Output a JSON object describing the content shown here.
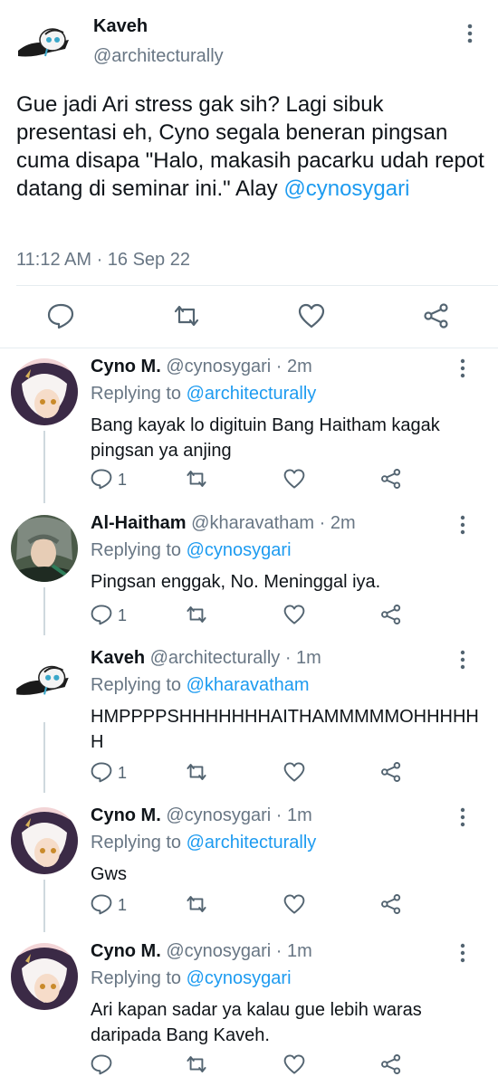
{
  "main_tweet": {
    "name": "Kaveh",
    "handle": "@architecturally",
    "text": "Gue jadi Ari stress gak sih? Lagi sibuk presentasi eh, Cyno segala beneran pingsan cuma disapa \"Halo, makasih pacarku udah repot datang di seminar ini.\" Alay ",
    "mention": "@cynosygari",
    "timestamp": "11:12 AM · 16 Sep 22",
    "actions": [
      "reply-icon",
      "retweet-icon",
      "like-icon",
      "share-icon"
    ]
  },
  "replies": [
    {
      "name": "Cyno M.",
      "meta": "@cynosygari · 2m",
      "replying_prefix": "Replying to ",
      "replying_to": "@architecturally",
      "text": "Bang kayak lo digituin Bang Haitham kagak pingsan ya anjing",
      "reply_count": "1"
    },
    {
      "name": "Al-Haitham",
      "meta": "@kharavatham · 2m",
      "replying_prefix": "Replying to ",
      "replying_to": "@cynosygari",
      "text": "Pingsan enggak, No. Meninggal iya.",
      "reply_count": "1"
    },
    {
      "name": "Kaveh",
      "meta": "@architecturally · 1m",
      "replying_prefix": "Replying to ",
      "replying_to": "@kharavatham",
      "text": "HMPPPPSHHHHHHHAITHAMMMMMOHHHHHH",
      "reply_count": "1"
    },
    {
      "name": "Cyno M.",
      "meta": "@cynosygari · 1m",
      "replying_prefix": "Replying to ",
      "replying_to": "@architecturally",
      "text": "Gws",
      "reply_count": "1"
    },
    {
      "name": "Cyno M.",
      "meta": "@cynosygari · 1m",
      "replying_prefix": "Replying to ",
      "replying_to": "@cynosygari",
      "text": "Ari kapan sadar ya kalau gue lebih waras daripada Bang Kaveh.",
      "reply_count": ""
    }
  ],
  "colors": {
    "accent": "#1d9bf0",
    "secondary_text": "#687684",
    "icon": "#536471",
    "thread_line": "#cfd9de"
  }
}
